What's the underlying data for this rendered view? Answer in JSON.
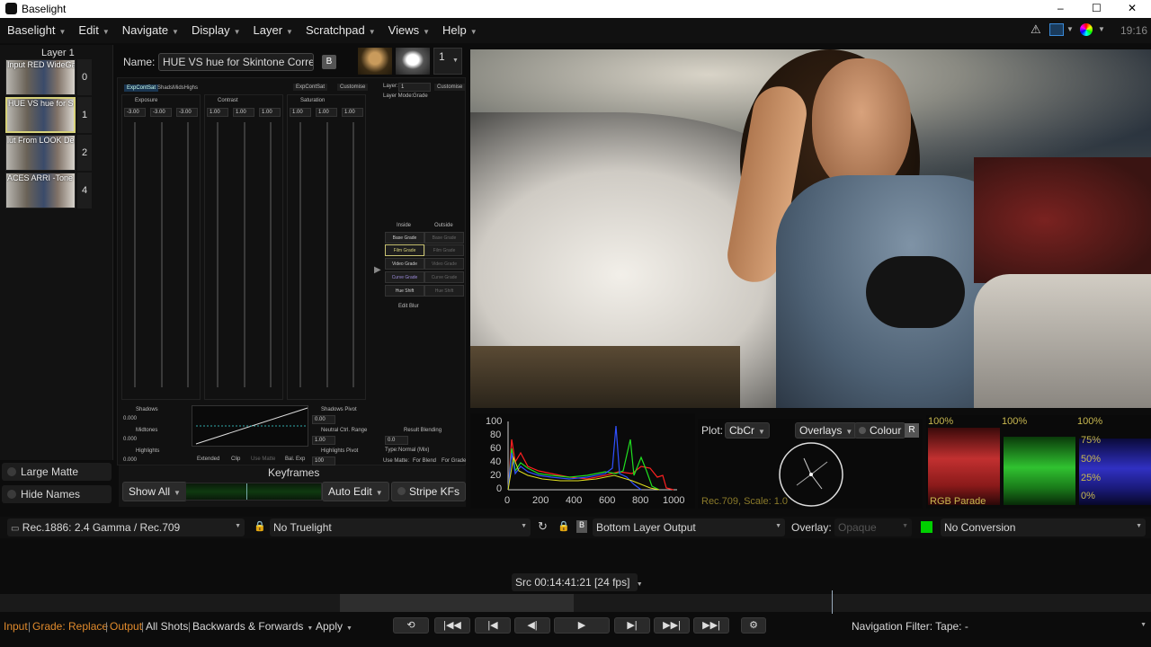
{
  "app": {
    "title": "Baselight",
    "clock": "19:16"
  },
  "window_controls": {
    "minimize": "–",
    "maximize": "☐",
    "close": "✕"
  },
  "menus": [
    "Baselight",
    "Edit",
    "Navigate",
    "Display",
    "Layer",
    "Scratchpad",
    "Views",
    "Help"
  ],
  "layers": {
    "title": "Layer 1",
    "items": [
      {
        "label": "Input RED WideGa...",
        "num": "0"
      },
      {
        "label": "HUE VS hue for S...",
        "num": "1"
      },
      {
        "label": "lut From LOOK De...",
        "num": "2"
      },
      {
        "label": "ACES ARRI -Tone ...",
        "num": "4"
      }
    ],
    "large_matte": "Large Matte",
    "hide_names": "Hide Names"
  },
  "name_bar": {
    "label": "Name:",
    "value": "HUE VS hue for Skintone Correc",
    "badge": "B",
    "count": "1"
  },
  "grade": {
    "tabs": [
      "ExpContSat",
      "ShadsMidsHighs"
    ],
    "tab2": [
      "ExpContSat",
      "Customise"
    ],
    "groups": [
      {
        "label": "Exposure",
        "values": [
          "-3.00",
          "-3.00",
          "-3.00"
        ]
      },
      {
        "label": "Contrast",
        "values": [
          "1.00",
          "1.00",
          "1.00"
        ]
      },
      {
        "label": "Saturation",
        "values": [
          "1.00",
          "1.00",
          "1.00"
        ]
      }
    ],
    "layer_label": "Layer:",
    "layer_value": "1",
    "customise": "Customise",
    "layer_mode_label": "Layer Mode:",
    "layer_mode_value": "Grade",
    "inside": "Inside",
    "outside": "Outside",
    "grade_buttons": [
      {
        "in": "Base Grade",
        "out": "Base Grade"
      },
      {
        "in": "Film Grade",
        "out": "Film Grade"
      },
      {
        "in": "Video Grade",
        "out": "Video Grade"
      },
      {
        "in": "Curve Grade",
        "out": "Curve Grade"
      },
      {
        "in": "Hue Shift",
        "out": "Hue Shift"
      }
    ],
    "edit_blur": "Edit Blur",
    "bottom_labels": [
      "Shadows",
      "Midtones",
      "Highlights"
    ],
    "bottom_vals": [
      "0.000",
      "0.000",
      "0.000"
    ],
    "right_labels": [
      "Shadows Pivot",
      "Neutral Ctrl. Range",
      "Highlights Pivot"
    ],
    "right_vals": [
      "0.00",
      "1.00",
      "100"
    ],
    "curve_opts": [
      "Extended",
      "Clip",
      "Use Matte",
      "Bal. Exp"
    ],
    "result_blending": "Result Blending",
    "rb_value": "0.0",
    "type_label": "Type:",
    "type_value": "Normal (Mix)",
    "use_matte": "Use Matte:",
    "for_blend": "For Blend",
    "for_grade": "For Grade"
  },
  "keyframes": {
    "title": "Keyframes",
    "show_all": "Show All",
    "auto_edit": "Auto Edit",
    "stripe": "Stripe KFs"
  },
  "histogram": {
    "y_ticks": [
      "100",
      "80",
      "60",
      "40",
      "20",
      "0"
    ],
    "x_ticks": [
      "0",
      "200",
      "400",
      "600",
      "800",
      "1000"
    ]
  },
  "vectorscope": {
    "plot_label": "Plot:",
    "plot_value": "CbCr",
    "overlays": "Overlays",
    "colour": "Colour",
    "r_btn": "R",
    "caption": "Rec.709, Scale: 1.0"
  },
  "parade": {
    "labels": [
      "100%",
      "75%",
      "50%",
      "25%",
      "0%"
    ],
    "caption": "RGB Parade"
  },
  "display_bar": {
    "colourspace": "Rec.1886: 2.4 Gamma / Rec.709",
    "truelight": "No Truelight",
    "output": "Bottom Layer Output",
    "overlay_label": "Overlay:",
    "overlay_value": "Opaque",
    "conversion": "No Conversion"
  },
  "timecode": "Src 00:14:41:21 [24 fps]",
  "status": {
    "input": "Input",
    "grade": "Grade: Replace",
    "output": "Output",
    "all_shots": "All Shots",
    "direction": "Backwards & Forwards",
    "apply": "Apply",
    "nav_filter": "Navigation Filter: Tape: -"
  },
  "transport": [
    "⟲",
    "|◀◀",
    "|◀",
    "◀|",
    "▶",
    "▶|",
    "▶▶|",
    "▶▶|"
  ],
  "colors": {
    "accent": "#d7d27a",
    "status_orange": "#e08a2c",
    "green": "#00d000"
  }
}
